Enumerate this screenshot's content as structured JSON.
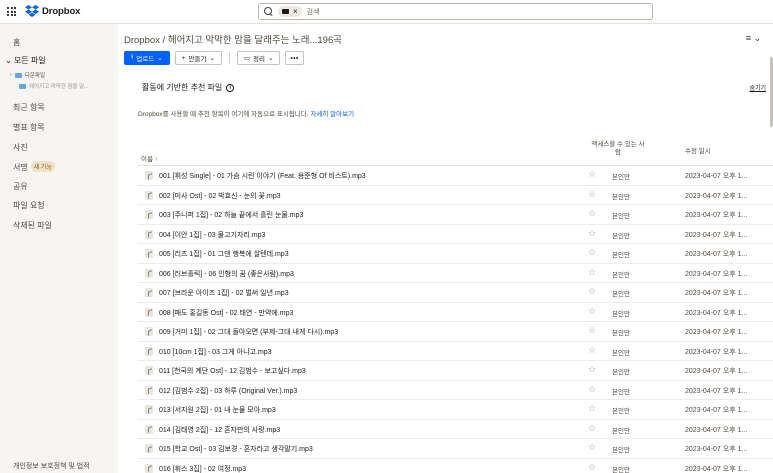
{
  "app": {
    "brand": "Dropbox"
  },
  "search": {
    "chip_label": "",
    "placeholder": "검색"
  },
  "sidebar": {
    "home": "홈",
    "all_files": "모든 파일",
    "tree": [
      {
        "label": "다운파일"
      },
      {
        "label": "헤어지고 막막한 맘을 달..."
      }
    ],
    "items": [
      {
        "label": "최근 항목"
      },
      {
        "label": "별표 항목"
      },
      {
        "label": "사진"
      },
      {
        "label": "서명",
        "badge": "새 기능"
      },
      {
        "label": "공유"
      },
      {
        "label": "파일 요청"
      },
      {
        "label": "삭제된 파일"
      }
    ],
    "footer": "개인정보 보호정책 및 법적"
  },
  "main": {
    "breadcrumb": "Dropbox / 헤어지고 막막한 맘을 달래주는 노래...196곡",
    "view_toggle": "≡ ⌄",
    "toolbar": {
      "upload": "업로드",
      "create": "만들기",
      "organize": "정리",
      "more": "•••"
    },
    "recommend": {
      "title": "활동에 기반한 추천 파일",
      "hide": "숨기기",
      "description": "Dropbox를 사용할 때 추천 항목이 여기에 자동으로 표시됩니다.",
      "learn_more": "자세히 알아보기"
    },
    "table": {
      "col_name": "이름 ↑",
      "col_access": "액세스할 수 있는 사람",
      "col_modified": "수정 일시",
      "rows": [
        {
          "name": "001 [휘성 Single] - 01 가슴 시린 이야기 (Feat. 용준형 Of 비스트).mp3",
          "access": "본인만",
          "modified": "2023-04-07 오후 1..."
        },
        {
          "name": "002 [미사 Ost] - 02 박효신 - 눈의 꽃.mp3",
          "access": "본인만",
          "modified": "2023-04-07 오후 1..."
        },
        {
          "name": "003 [주니퍼 1집] - 02 하늘 끝에서 흘린 눈물.mp3",
          "access": "본인만",
          "modified": "2023-04-07 오후 1..."
        },
        {
          "name": "004 [이안 1집] - 03 물고기자리.mp3",
          "access": "본인만",
          "modified": "2023-04-07 오후 1..."
        },
        {
          "name": "005 [리즈 1집] - 01 그댄 행복에 살텐데.mp3",
          "access": "본인만",
          "modified": "2023-04-07 오후 1..."
        },
        {
          "name": "006 [러브홀릭] - 06 인형의 꿈 (좋은사람).mp3",
          "access": "본인만",
          "modified": "2023-04-07 오후 1..."
        },
        {
          "name": "007 [브라운 아이즈 1집] - 02 벌써 일년.mp3",
          "access": "본인만",
          "modified": "2023-04-07 오후 1..."
        },
        {
          "name": "008 [패도 홍길동 Ost] - 02 태연 - 만약에.mp3",
          "access": "본인만",
          "modified": "2023-04-07 오후 1..."
        },
        {
          "name": "009 [거미 1집] - 02 그대 돌아오면 (부제-그대 내게 다시).mp3",
          "access": "본인만",
          "modified": "2023-04-07 오후 1..."
        },
        {
          "name": "010 [10cm 1집] - 03 그게 아니고.mp3",
          "access": "본인만",
          "modified": "2023-04-07 오후 1..."
        },
        {
          "name": "011 [천국의 계단 Ost] - 12 김범수 - 보고싶다.mp3",
          "access": "본인만",
          "modified": "2023-04-07 오후 1..."
        },
        {
          "name": "012 [김범수 2집] - 03 하루 (Original Ver.).mp3",
          "access": "본인만",
          "modified": "2023-04-07 오후 1..."
        },
        {
          "name": "013 [서지원 2집] - 01 내 눈물 모아.mp3",
          "access": "본인만",
          "modified": "2023-04-07 오후 1..."
        },
        {
          "name": "014 [김태영 2집] - 12 혼자만의 사랑.mp3",
          "access": "본인만",
          "modified": "2023-04-07 오후 1..."
        },
        {
          "name": "015 [학교 Ost] - 03 김보경 - 혼자라고 생각말기.mp3",
          "access": "본인만",
          "modified": "2023-04-07 오후 1..."
        },
        {
          "name": "016 [휘스 3집] - 02 여정.mp3",
          "access": "본인만",
          "modified": "2023-04-07 오후 1..."
        }
      ]
    }
  }
}
